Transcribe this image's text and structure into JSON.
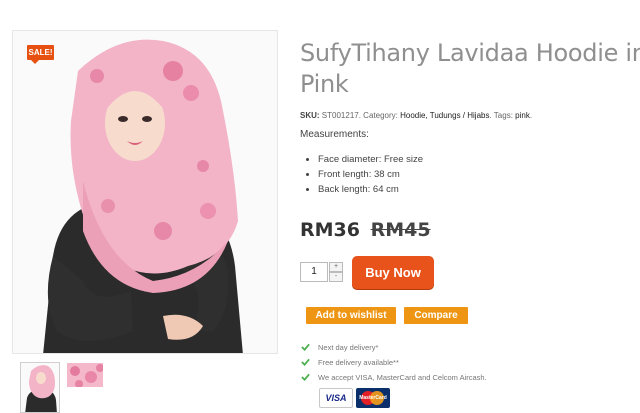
{
  "gallery": {
    "sale_badge": "SALE!",
    "thumbnails": [
      "thumbnail-front",
      "thumbnail-fabric"
    ]
  },
  "product": {
    "title_line1": "SufyTihany Lavidaa Hoodie in",
    "title_line2": "Pink",
    "sku_label": "SKU:",
    "sku": "ST001217",
    "category_label": "Category:",
    "categories": "Hoodie, Tudungs / Hijabs",
    "tags_label": "Tags:",
    "tags": "pink",
    "measurements_heading": "Measurements:",
    "measurements": [
      "Face diameter: Free size",
      "Front length: 38 cm",
      "Back length: 64 cm"
    ],
    "price_current": "RM36",
    "price_old": "RM45"
  },
  "purchase": {
    "quantity": "1",
    "qty_up": "+",
    "qty_down": "-",
    "buy_label": "Buy Now",
    "wishlist_label": "Add to wishlist",
    "compare_label": "Compare"
  },
  "features": [
    "Next day delivery*",
    "Free delivery available**",
    "We accept VISA, MasterCard and Celcom Aircash."
  ],
  "payment": {
    "visa": "VISA",
    "mastercard": "MasterCard"
  },
  "colors": {
    "accent": "#e8531c",
    "secondary": "#ee9613",
    "check": "#4caf50"
  }
}
